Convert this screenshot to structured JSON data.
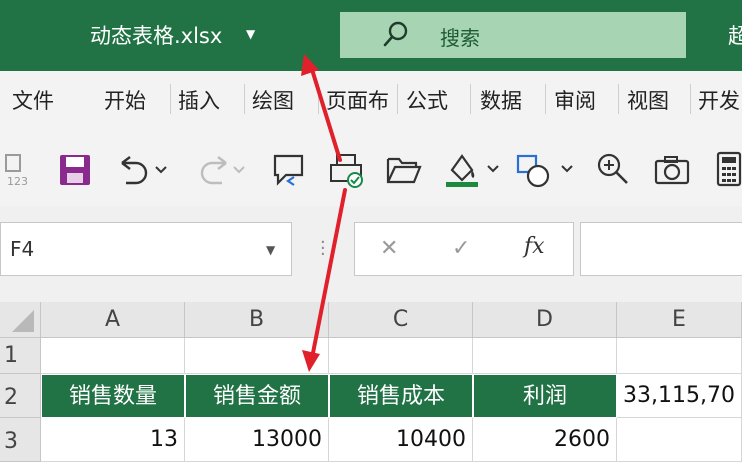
{
  "titlebar": {
    "file_name": "动态表格.xlsx",
    "search_label": "搜索",
    "right_text": "超"
  },
  "colors": {
    "brand_green": "#217346",
    "search_bg": "#a7d5b4",
    "annotation_red": "#e0202a"
  },
  "menu": {
    "items": [
      "文件",
      "开始",
      "插入",
      "绘图",
      "页面布",
      "公式",
      "数据",
      "审阅",
      "视图",
      "开发"
    ]
  },
  "toolbar": {
    "icons": [
      "format-painter-123-icon",
      "save-icon",
      "undo-icon",
      "redo-icon",
      "comment-icon",
      "print-preview-icon",
      "open-folder-icon",
      "fill-color-icon",
      "shapes-icon",
      "zoom-in-icon",
      "camera-icon",
      "calculator-icon"
    ]
  },
  "formula_bar": {
    "name_box": "F4",
    "cancel_symbol": "✕",
    "enter_symbol": "✓",
    "fx_label": "fx",
    "formula_value": ""
  },
  "sheet": {
    "columns": [
      "A",
      "B",
      "C",
      "D",
      "E"
    ],
    "rows": [
      "1",
      "2",
      "3"
    ],
    "headers": [
      "销售数量",
      "销售金额",
      "销售成本",
      "利润"
    ],
    "values": [
      "13",
      "13000",
      "10400",
      "2600"
    ],
    "e2_value": "33,115,70"
  }
}
